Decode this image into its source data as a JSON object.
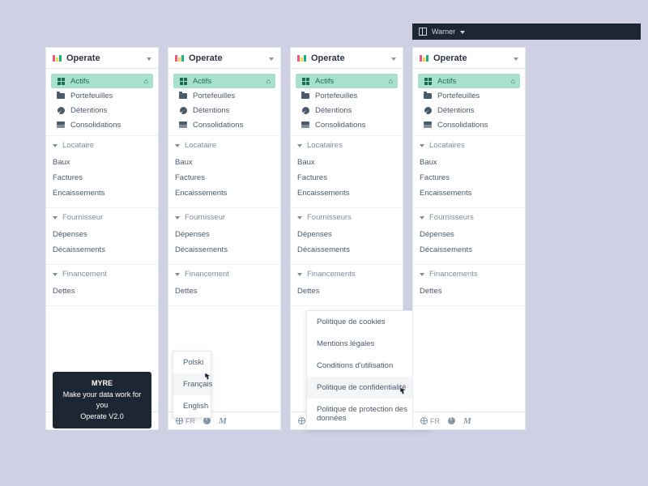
{
  "topbar": {
    "workspace": "Warner"
  },
  "app": {
    "title": "Operate"
  },
  "nav": {
    "items": [
      {
        "label": "Actifs"
      },
      {
        "label": "Portefeuilles"
      },
      {
        "label": "Détentions"
      },
      {
        "label": "Consolidations"
      }
    ]
  },
  "panels": [
    {
      "sections": [
        {
          "title": "Locataire",
          "rows": [
            "Baux",
            "Factures",
            "Encaissements"
          ]
        },
        {
          "title": "Fournisseur",
          "rows": [
            "Dépenses",
            "Décaissements"
          ]
        },
        {
          "title": "Financement",
          "rows": [
            "Dettes"
          ]
        }
      ]
    },
    {
      "sections": [
        {
          "title": "Locataire",
          "rows": [
            "Baux",
            "Factures",
            "Encaissements"
          ]
        },
        {
          "title": "Fournisseur",
          "rows": [
            "Dépenses",
            "Décaissements"
          ]
        },
        {
          "title": "Financement",
          "rows": [
            "Dettes"
          ]
        }
      ]
    },
    {
      "sections": [
        {
          "title": "Locataires",
          "rows": [
            "Baux",
            "Factures",
            "Encaissements"
          ]
        },
        {
          "title": "Fournisseurs",
          "rows": [
            "Dépenses",
            "Décaissements"
          ]
        },
        {
          "title": "Financements",
          "rows": [
            "Dettes"
          ]
        }
      ]
    },
    {
      "sections": [
        {
          "title": "Locataires",
          "rows": [
            "Baux",
            "Factures",
            "Encaissements"
          ]
        },
        {
          "title": "Fournisseurs",
          "rows": [
            "Dépenses",
            "Décaissements"
          ]
        },
        {
          "title": "Financements",
          "rows": [
            "Dettes"
          ]
        }
      ]
    }
  ],
  "tooltip": {
    "line1": "MYRE",
    "line2": "Make your data work for you",
    "line3": "Operate V2.0"
  },
  "lang_menu": {
    "options": [
      "Polski",
      "Français",
      "English"
    ],
    "hover_index": 1
  },
  "legal_menu": {
    "options": [
      "Politique de cookies",
      "Mentions légales",
      "Conditions d'utilisation",
      "Politique de confidentialité",
      "Politique de protection des données"
    ],
    "hover_index": 3
  },
  "footer": {
    "lang": "FR"
  }
}
